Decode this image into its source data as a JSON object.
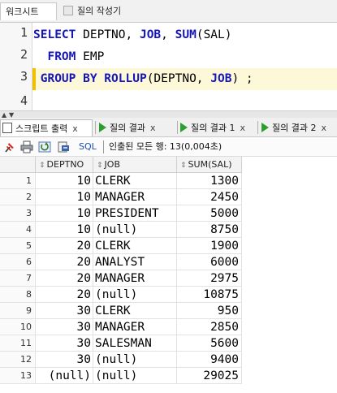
{
  "window_tabs": [
    {
      "label": "워크시트"
    },
    {
      "label": "질의 작성기"
    }
  ],
  "editor": {
    "line_numbers": [
      "1",
      "2",
      "3",
      "4"
    ],
    "lines": [
      [
        {
          "t": "SELECT",
          "k": true
        },
        {
          "t": " DEPTNO, ",
          "k": false
        },
        {
          "t": "JOB",
          "k": true
        },
        {
          "t": ", ",
          "k": false
        },
        {
          "t": "SUM",
          "k": true
        },
        {
          "t": "(SAL)",
          "k": false
        }
      ],
      [
        {
          "t": "  FROM",
          "k": true
        },
        {
          "t": " EMP",
          "k": false
        }
      ],
      [
        {
          "t": " GROUP BY ROLLUP",
          "k": true
        },
        {
          "t": "(DEPTNO, ",
          "k": false
        },
        {
          "t": "JOB",
          "k": true
        },
        {
          "t": ") ;",
          "k": false
        }
      ],
      []
    ]
  },
  "result_tabs": [
    {
      "label": "스크립트 출력",
      "close": "x",
      "icon": "script-output-icon"
    },
    {
      "label": "질의 결과",
      "close": "x",
      "icon": "run-icon"
    },
    {
      "label": "질의 결과 1",
      "close": "x",
      "icon": "run-icon"
    },
    {
      "label": "질의 결과 2",
      "close": "x",
      "icon": "run-icon"
    }
  ],
  "toolbar": {
    "sql_label": "SQL",
    "status": "인출된 모든 행: 13(0,004초)",
    "icons": [
      "pin-icon",
      "print-icon",
      "refresh-icon",
      "export-icon"
    ]
  },
  "grid": {
    "columns": [
      "DEPTNO",
      "JOB",
      "SUM(SAL)"
    ],
    "rows": [
      [
        "1",
        "10",
        "CLERK",
        "1300"
      ],
      [
        "2",
        "10",
        "MANAGER",
        "2450"
      ],
      [
        "3",
        "10",
        "PRESIDENT",
        "5000"
      ],
      [
        "4",
        "10",
        "(null)",
        "8750"
      ],
      [
        "5",
        "20",
        "CLERK",
        "1900"
      ],
      [
        "6",
        "20",
        "ANALYST",
        "6000"
      ],
      [
        "7",
        "20",
        "MANAGER",
        "2975"
      ],
      [
        "8",
        "20",
        "(null)",
        "10875"
      ],
      [
        "9",
        "30",
        "CLERK",
        "950"
      ],
      [
        "10",
        "30",
        "MANAGER",
        "2850"
      ],
      [
        "11",
        "30",
        "SALESMAN",
        "5600"
      ],
      [
        "12",
        "30",
        "(null)",
        "9400"
      ],
      [
        "13",
        "(null)",
        "(null)",
        "29025"
      ]
    ]
  },
  "colors": {
    "keyword": "#1616b8",
    "current_line_bar": "#f0c000",
    "run_icon": "#2e9e2e"
  }
}
